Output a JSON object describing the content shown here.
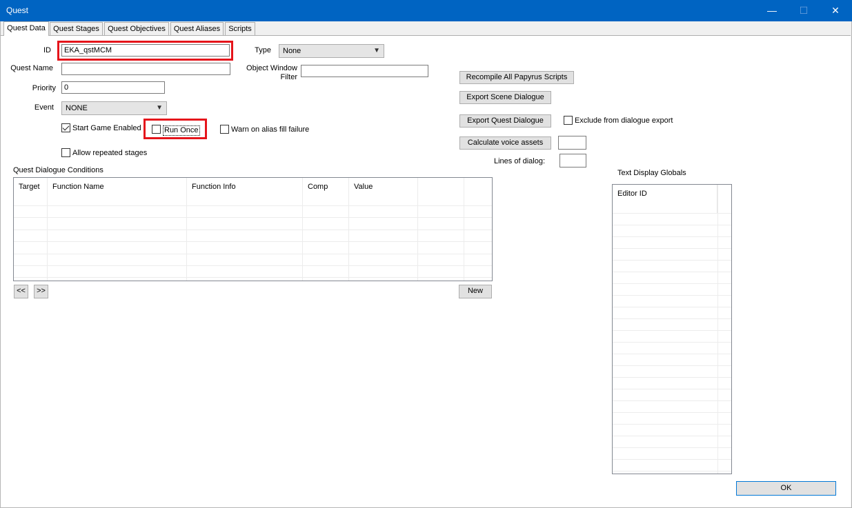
{
  "window": {
    "title": "Quest",
    "minimize_glyph": "—",
    "maximize_glyph": "☐",
    "close_glyph": "✕"
  },
  "tabs": [
    {
      "label": "Quest Data",
      "active": true
    },
    {
      "label": "Quest Stages",
      "active": false
    },
    {
      "label": "Quest Objectives",
      "active": false
    },
    {
      "label": "Quest Aliases",
      "active": false
    },
    {
      "label": "Scripts",
      "active": false
    }
  ],
  "form": {
    "id_label": "ID",
    "id_value": "EKA_qstMCM",
    "quest_name_label": "Quest Name",
    "quest_name_value": "",
    "priority_label": "Priority",
    "priority_value": "0",
    "event_label": "Event",
    "event_value": "NONE",
    "type_label": "Type",
    "type_value": "None",
    "object_window_filter_label_line1": "Object Window",
    "object_window_filter_label_line2": "Filter",
    "object_window_filter_value": "",
    "start_game_enabled_label": "Start Game Enabled",
    "start_game_enabled_checked": true,
    "run_once_label": "Run Once",
    "run_once_checked": false,
    "warn_alias_label": "Warn on alias fill failure",
    "warn_alias_checked": false,
    "allow_repeated_label": "Allow repeated stages",
    "allow_repeated_checked": false
  },
  "actions": {
    "recompile_label": "Recompile All Papyrus Scripts",
    "export_scene_label": "Export Scene Dialogue",
    "export_quest_label": "Export Quest Dialogue",
    "exclude_label": "Exclude from dialogue export",
    "exclude_checked": false,
    "calc_voice_label": "Calculate voice assets",
    "calc_voice_value": "",
    "lines_of_dialog_label": "Lines of dialog:",
    "lines_of_dialog_value": ""
  },
  "conditions": {
    "title": "Quest Dialogue Conditions",
    "columns": [
      "Target",
      "Function Name",
      "Function Info",
      "Comp",
      "Value",
      ""
    ],
    "rows": [],
    "prev_label": "<<",
    "next_label": ">>",
    "new_label": "New"
  },
  "globals": {
    "title": "Text Display Globals",
    "column": "Editor ID",
    "rows": []
  },
  "footer": {
    "ok_label": "OK"
  },
  "colors": {
    "titlebar": "#0064c2",
    "highlight": "#e5141b"
  }
}
